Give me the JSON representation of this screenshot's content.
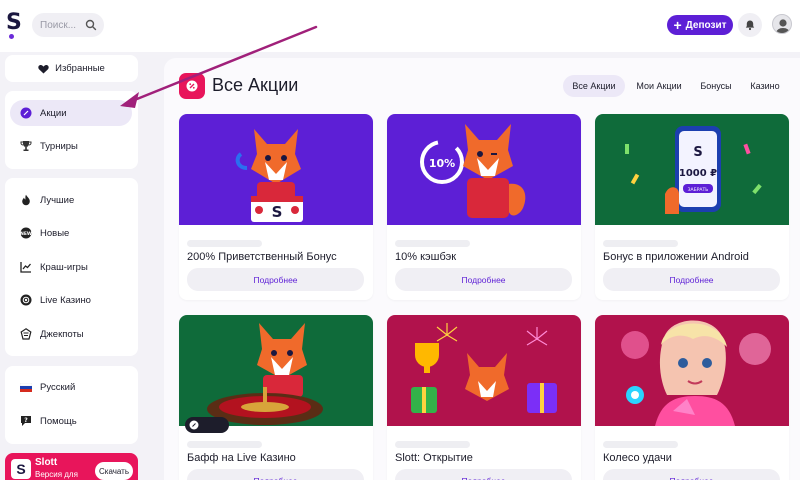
{
  "colors": {
    "accent": "#5d1fd6",
    "brand_pink": "#e8155b",
    "active_bg": "#ece8f7",
    "arrow": "#a0207a"
  },
  "header": {
    "logo_letter": "S",
    "search": {
      "placeholder": "Поиск..."
    },
    "deposit_label": "Депозит",
    "icons": [
      "search-icon",
      "plus-icon",
      "bell-icon",
      "avatar"
    ]
  },
  "sidebar": {
    "favorites_label": "Избранные",
    "primary": [
      {
        "label": "Акции",
        "icon": "promotions-icon",
        "active": true
      },
      {
        "label": "Турниры",
        "icon": "trophy-icon",
        "active": false
      }
    ],
    "categories": [
      {
        "label": "Лучшие",
        "icon": "flame-icon"
      },
      {
        "label": "Новые",
        "icon": "new-icon"
      },
      {
        "label": "Краш-игры",
        "icon": "chart-icon"
      },
      {
        "label": "Live Казино",
        "icon": "chip-icon"
      },
      {
        "label": "Джекпоты",
        "icon": "jackpot-icon"
      }
    ],
    "settings": [
      {
        "label": "Русский",
        "icon": "russia-flag-icon"
      },
      {
        "label": "Помощь",
        "icon": "help-icon"
      }
    ],
    "app_promo": {
      "title": "Slott",
      "subtitle": "Версия для",
      "button": "Скачать"
    }
  },
  "main": {
    "title": "Все Акции",
    "tabs": [
      {
        "label": "Все Акции",
        "active": true
      },
      {
        "label": "Мои Акции",
        "active": false
      },
      {
        "label": "Бонусы",
        "active": false
      },
      {
        "label": "Казино",
        "active": false
      }
    ],
    "more_label": "Подробнее",
    "cards": [
      {
        "title": "200% Приветственный Бонус",
        "bg": "#5d1fd6"
      },
      {
        "title": "10% кэшбэк",
        "bg": "#5d1fd6",
        "badge": "10%"
      },
      {
        "title": "Бонус в приложении Android",
        "bg": "#0f6b3a",
        "badge": "1000 ₽",
        "badge2": "ЗАБРАТЬ"
      },
      {
        "title": "Бафф на Live Казино",
        "bg": "#0f6b3a"
      },
      {
        "title": "Slott: Открытие",
        "bg": "#b1124c"
      },
      {
        "title": "Колесо удачи",
        "bg": "#b1124c"
      }
    ]
  }
}
